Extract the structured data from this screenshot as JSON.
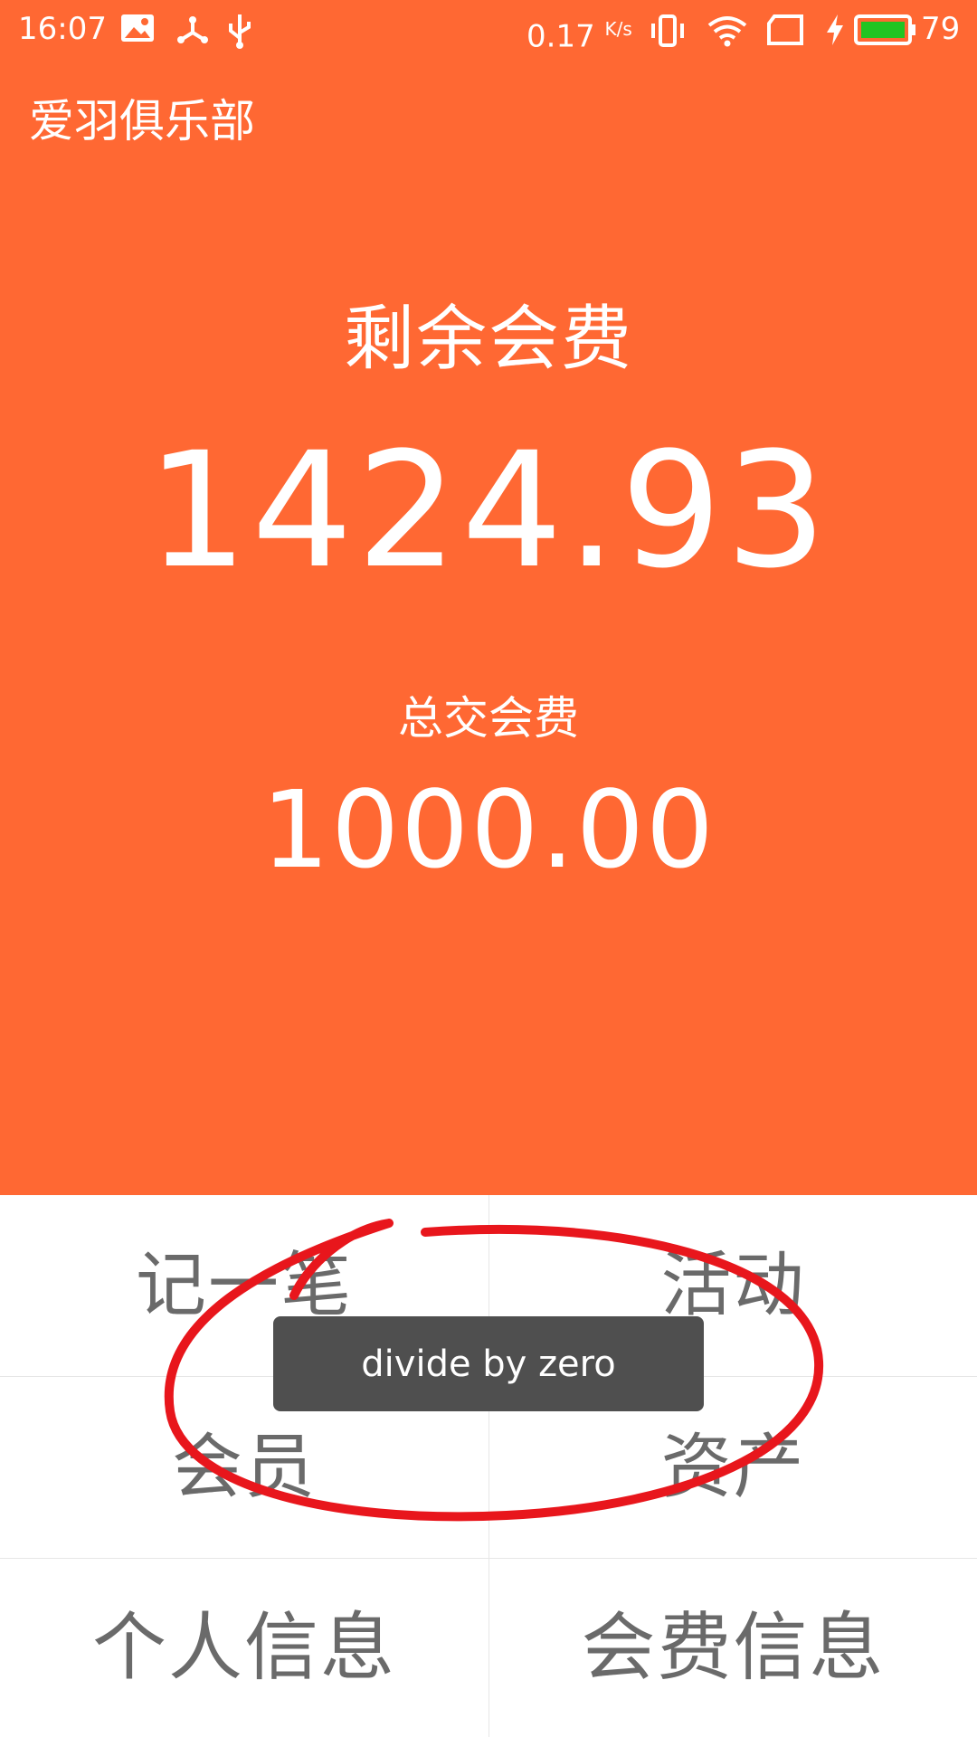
{
  "status_bar": {
    "time": "16:07",
    "network_speed": "0.17",
    "network_speed_unit": "K/s",
    "battery_percent": "79",
    "icons": [
      "image-icon",
      "share-icon",
      "usb-icon",
      "vibrate-icon",
      "wifi-icon",
      "sim-icon",
      "charging-icon",
      "battery-icon"
    ],
    "battery_color": "#22c422"
  },
  "app_bar": {
    "title": "爱羽俱乐部"
  },
  "summary": {
    "remaining_label": "剩余会费",
    "remaining_value": "1424.93",
    "total_label": "总交会费",
    "total_value": "1000.00"
  },
  "grid": {
    "record": "记一笔",
    "activity": "活动",
    "members": "会员",
    "assets": "资产",
    "personal_info": "个人信息",
    "fee_info": "会费信息"
  },
  "toast": {
    "message": "divide by zero"
  },
  "colors": {
    "header_bg": "#ff6833",
    "toast_bg": "#4f4f4f",
    "annotation": "#e8161c"
  }
}
